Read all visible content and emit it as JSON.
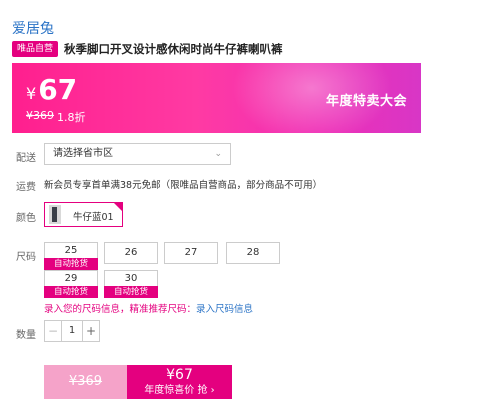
{
  "brand": "爱居兔",
  "product": {
    "badge": "唯品自营",
    "title": "秋季脚口开叉设计感休闲时尚牛仔裤喇叭裤"
  },
  "banner": {
    "currency": "¥",
    "price": "67",
    "original_price": "¥369",
    "discount": "1.8折",
    "event": "年度特卖大会",
    "colors": {
      "start": "#ff1f8e",
      "end": "#d836c6"
    }
  },
  "delivery": {
    "label": "配送",
    "placeholder": "请选择省市区"
  },
  "shipping": {
    "label": "运费",
    "text": "新会员专享首单满38元免邮（限唯品自营商品，部分商品不可用）"
  },
  "color": {
    "label": "颜色",
    "options": [
      {
        "name": "牛仔蓝01",
        "selected": true
      }
    ]
  },
  "size": {
    "label": "尺码",
    "options": [
      {
        "value": "25",
        "tag": "自动抢货"
      },
      {
        "value": "26"
      },
      {
        "value": "27"
      },
      {
        "value": "28"
      },
      {
        "value": "29",
        "tag": "自动抢货"
      },
      {
        "value": "30",
        "tag": "自动抢货"
      }
    ],
    "hint": "录入您的尺码信息，精准推荐尺码：",
    "hint_link": "录入尺码信息"
  },
  "quantity": {
    "label": "数量",
    "value": "1",
    "minus": "−",
    "plus": "+"
  },
  "buy": {
    "old_price": "¥369",
    "price": "¥67",
    "action": "年度惊喜价 抢 ›"
  },
  "accent_color": "#e4007f",
  "link_color": "#2a73c6"
}
